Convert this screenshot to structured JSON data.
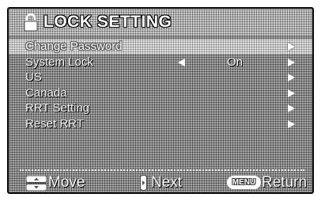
{
  "header": {
    "title": "LOCK SETTING",
    "icon": "lock-icon"
  },
  "menu": {
    "items": [
      {
        "label": "Change Password",
        "has_arrow": true,
        "selected": true
      },
      {
        "label": "System Lock",
        "value": "On",
        "has_left_arrow": true,
        "has_arrow": true,
        "selected": false
      },
      {
        "label": "US",
        "has_arrow": true,
        "selected": false
      },
      {
        "label": "Canada",
        "has_arrow": true,
        "selected": false
      },
      {
        "label": "RRT Setting",
        "has_arrow": true,
        "selected": false
      },
      {
        "label": "Reset RRT",
        "has_arrow": true,
        "selected": false
      }
    ]
  },
  "footer": {
    "move_label": "Move",
    "next_label": "Next",
    "menu_key_label": "MENU",
    "return_label": "Return"
  },
  "colors": {
    "text": "#ffffff",
    "panel": "#8d8d8d",
    "highlight": "#cfcfcf"
  }
}
